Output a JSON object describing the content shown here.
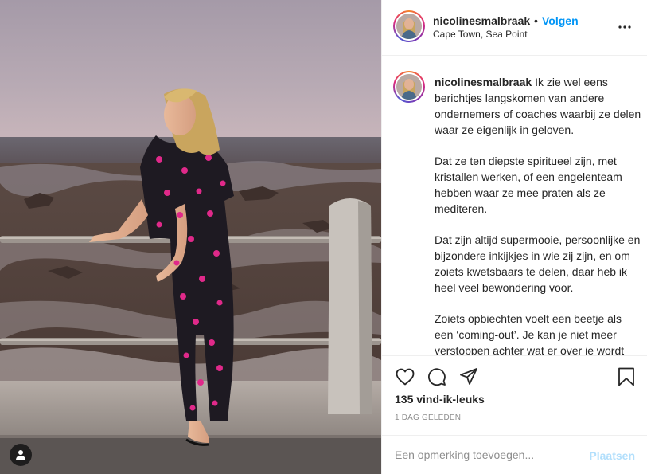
{
  "post": {
    "username": "nicolinesmalbraak",
    "separator": "•",
    "follow_label": "Volgen",
    "location": "Cape Town, Sea Point",
    "more_icon": "more-dots-icon"
  },
  "caption": {
    "username": "nicolinesmalbraak",
    "paragraphs": [
      "Ik zie wel eens berichtjes langskomen van andere ondernemers of coaches waarbij ze delen waar ze eigenlijk in geloven.",
      "Dat ze ten diepste spiritueel zijn, met kristallen werken, of een engelenteam hebben waar ze mee praten als ze mediteren.",
      "Dat zijn altijd supermooie, persoonlijke en bijzondere inkijkjes in wie zij zijn, en om zoiets kwetsbaars te delen, daar heb ik heel veel bewondering voor.",
      "Zoiets opbiechten voelt een beetje als een ‘coming-out’. Je kan je niet meer verstoppen achter wat er over je wordt aangenomen, maar je laat je helemaal zien."
    ]
  },
  "stats": {
    "likes": "135 vind-ik-leuks",
    "timestamp": "1 DAG GELEDEN"
  },
  "comment": {
    "placeholder": "Een opmerking toevoegen...",
    "post_label": "Plaatsen"
  },
  "colors": {
    "link_blue": "#0095f6",
    "post_disabled": "#b2dffc",
    "text": "#262626",
    "muted": "#8e8e8e"
  }
}
